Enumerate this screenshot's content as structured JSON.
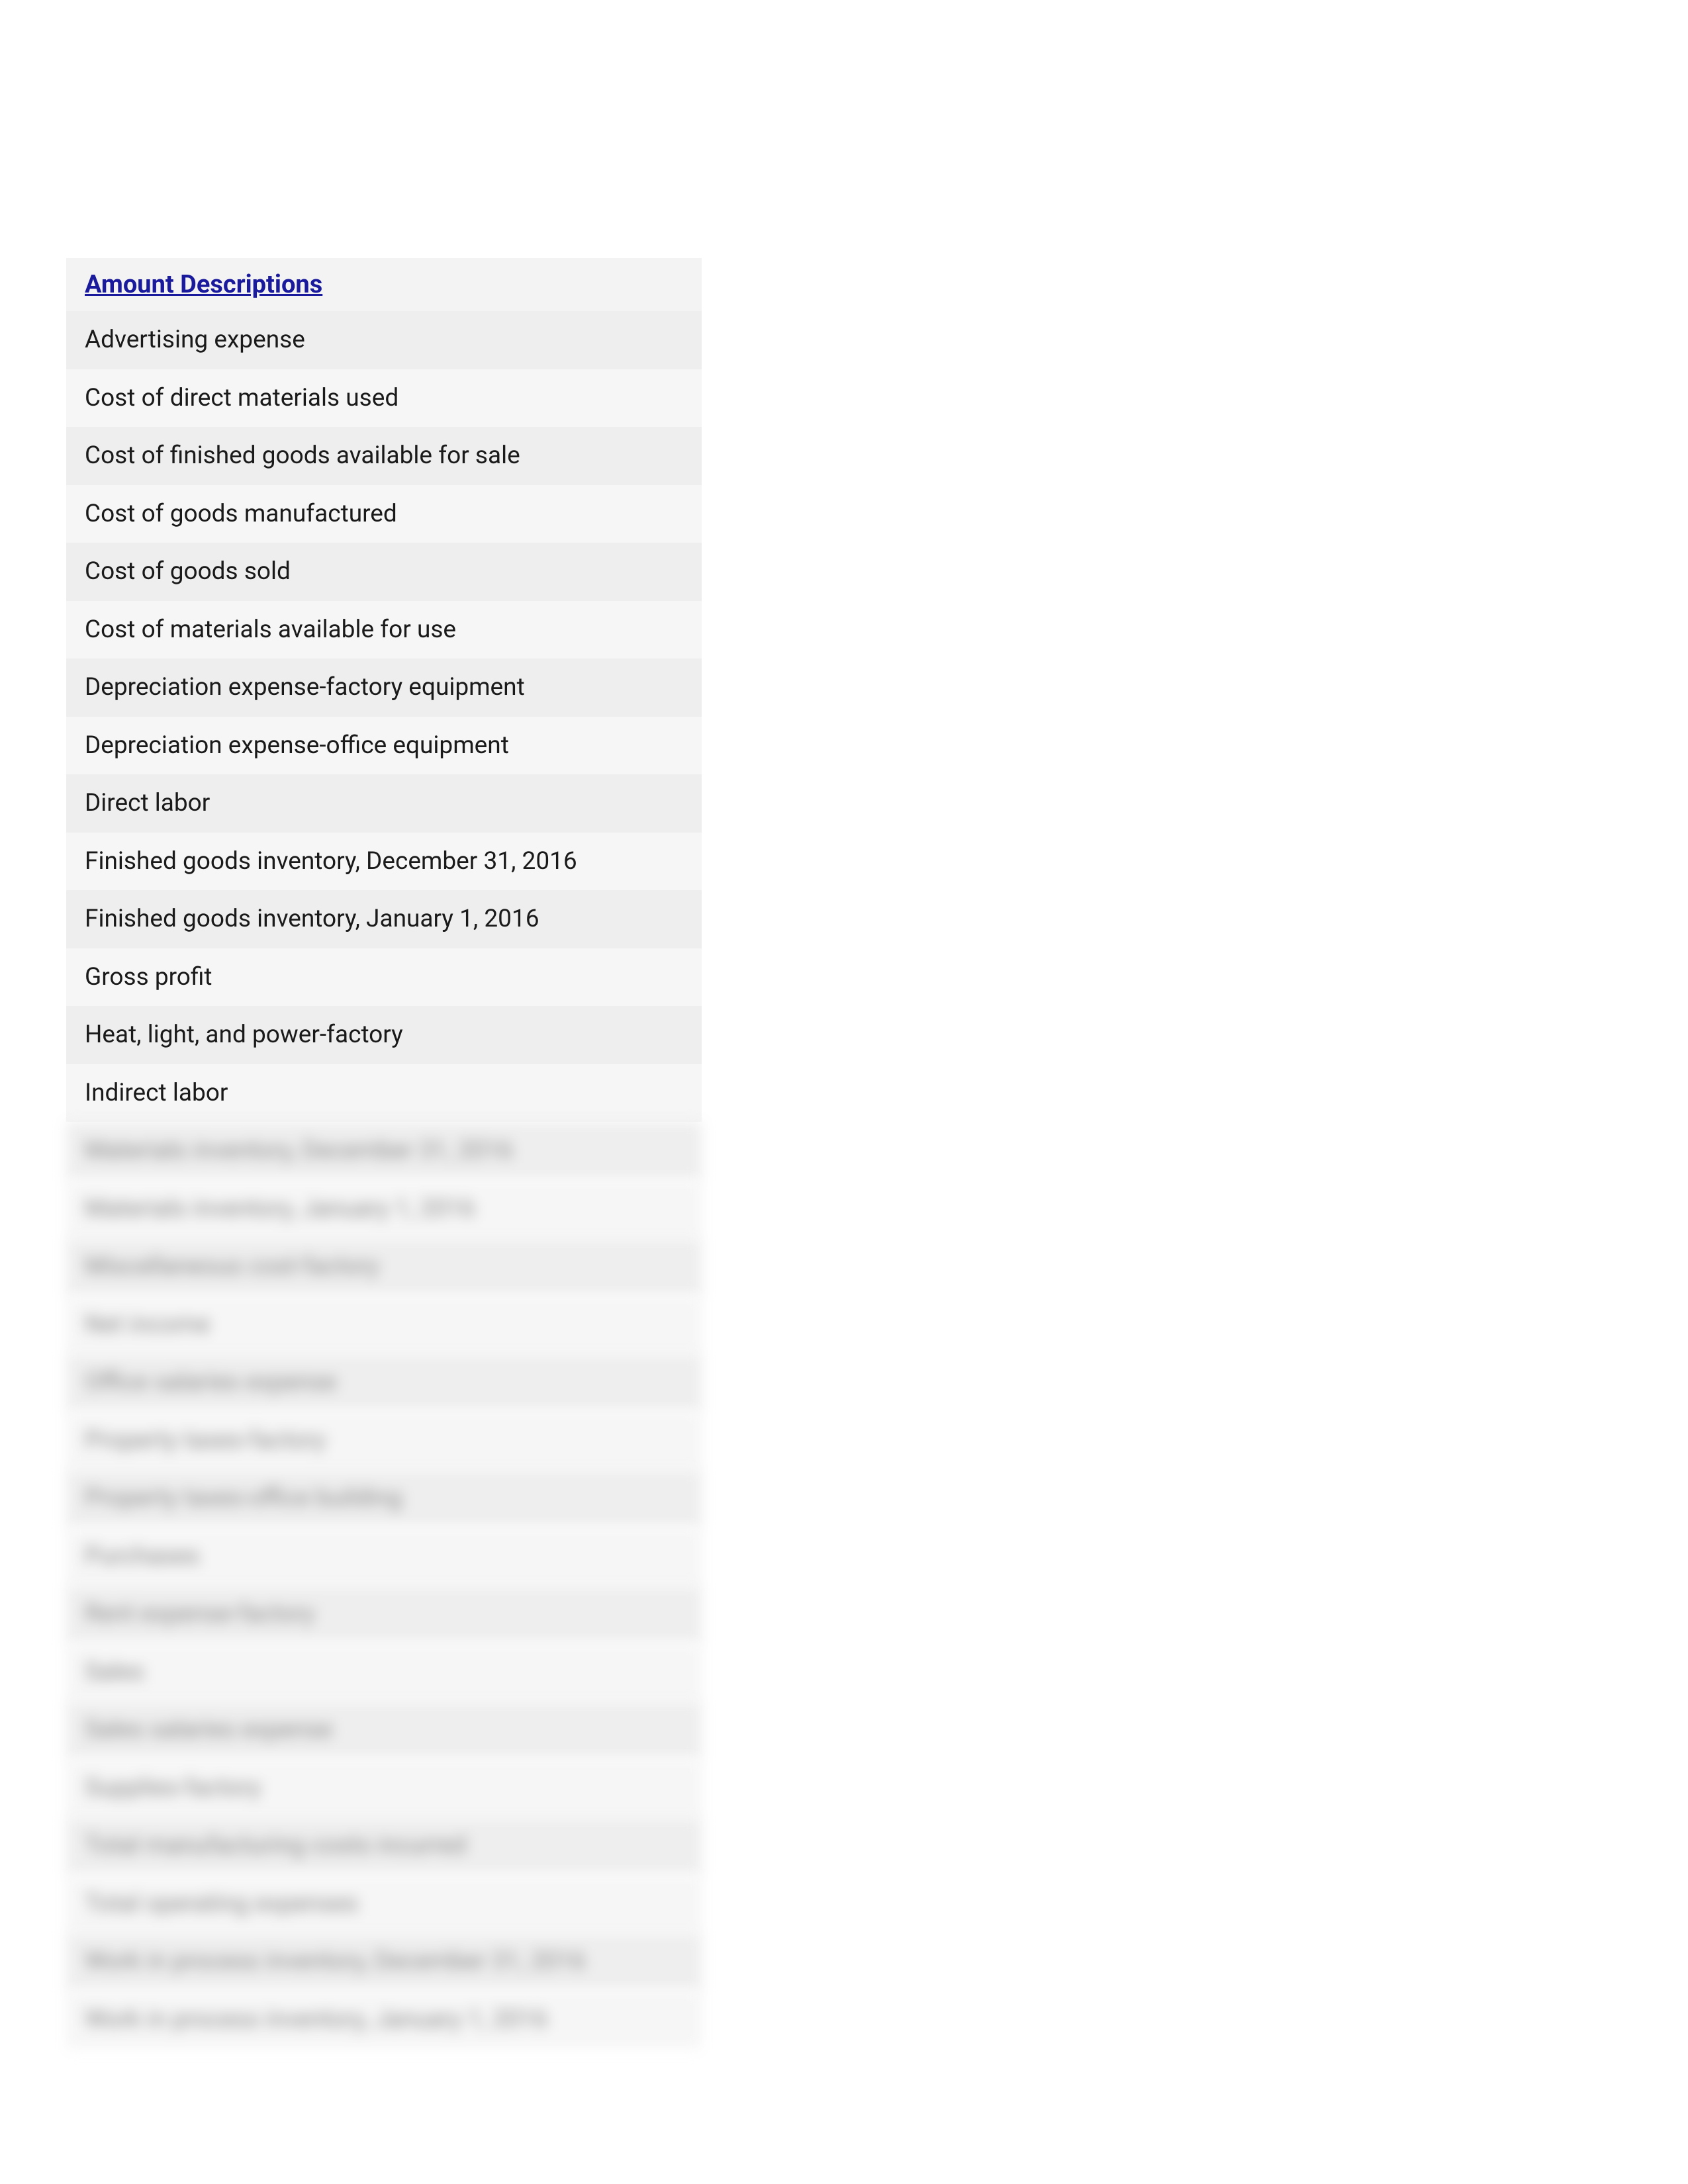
{
  "header": {
    "title": "Amount Descriptions"
  },
  "rows": [
    {
      "label": "Advertising expense",
      "blurred": false
    },
    {
      "label": "Cost of direct materials used",
      "blurred": false
    },
    {
      "label": "Cost of finished goods available for sale",
      "blurred": false
    },
    {
      "label": "Cost of goods manufactured",
      "blurred": false
    },
    {
      "label": "Cost of goods sold",
      "blurred": false
    },
    {
      "label": "Cost of materials available for use",
      "blurred": false
    },
    {
      "label": "Depreciation expense-factory equipment",
      "blurred": false
    },
    {
      "label": "Depreciation expense-office equipment",
      "blurred": false
    },
    {
      "label": "Direct labor",
      "blurred": false
    },
    {
      "label": "Finished goods inventory, December 31, 2016",
      "blurred": false
    },
    {
      "label": "Finished goods inventory, January 1, 2016",
      "blurred": false
    },
    {
      "label": "Gross profit",
      "blurred": false
    },
    {
      "label": "Heat, light, and power-factory",
      "blurred": false
    },
    {
      "label": "Indirect labor",
      "blurred": false
    },
    {
      "label": "Materials inventory, December 31, 2016",
      "blurred": true
    },
    {
      "label": "Materials inventory, January 1, 2016",
      "blurred": true
    },
    {
      "label": "Miscellaneous cost-factory",
      "blurred": true
    },
    {
      "label": "Net income",
      "blurred": true
    },
    {
      "label": "Office salaries expense",
      "blurred": true
    },
    {
      "label": "Property taxes-factory",
      "blurred": true
    },
    {
      "label": "Property taxes-office building",
      "blurred": true
    },
    {
      "label": "Purchases",
      "blurred": true
    },
    {
      "label": "Rent expense-factory",
      "blurred": true
    },
    {
      "label": "Sales",
      "blurred": true
    },
    {
      "label": "Sales salaries expense",
      "blurred": true
    },
    {
      "label": "Supplies-factory",
      "blurred": true
    },
    {
      "label": "Total manufacturing costs incurred",
      "blurred": true
    },
    {
      "label": "Total operating expenses",
      "blurred": true
    },
    {
      "label": "Work in process inventory, December 31, 2016",
      "blurred": true
    },
    {
      "label": "Work in process inventory, January 1, 2016",
      "blurred": true
    }
  ]
}
